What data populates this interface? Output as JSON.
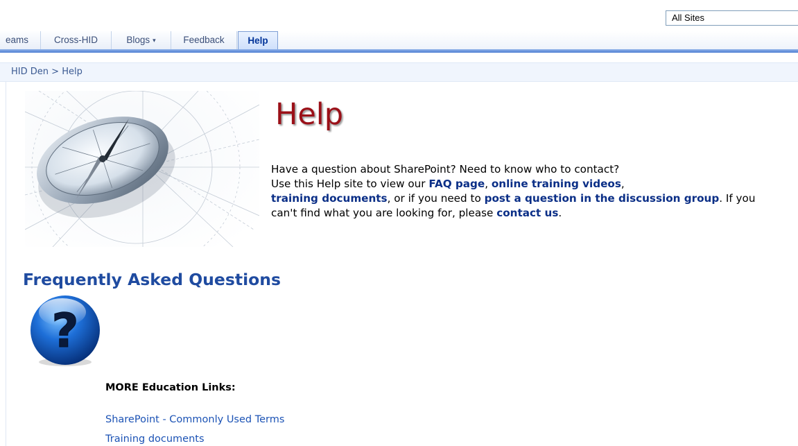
{
  "search": {
    "scope": "All Sites"
  },
  "nav": {
    "tabs": [
      {
        "label": "eams"
      },
      {
        "label": "Cross-HID"
      },
      {
        "label": "Blogs"
      },
      {
        "label": "Feedback"
      },
      {
        "label": "Help"
      }
    ],
    "dropdown_glyph": "▾"
  },
  "breadcrumb": {
    "site": "HID Den",
    "separator": ">",
    "current": "Help"
  },
  "main": {
    "title": "Help",
    "intro": {
      "p1": "Have a question about SharePoint?  Need to know who to contact?",
      "p2": "Use this Help site to view our ",
      "faq_link": "FAQ page",
      "sep1": ", ",
      "videos_link": "online training videos",
      "sep2": ",",
      "docs_link": "training documents",
      "p3": ", or if you need to ",
      "post_link": "post a question in the discussion group",
      "p4": ".  If you can't find what you are looking for, please ",
      "contact_link": "contact us",
      "p5": "."
    },
    "faq_heading": "Frequently Asked Questions",
    "more_heading": "MORE Education Links:",
    "links": [
      {
        "label": "SharePoint - Commonly Used Terms"
      },
      {
        "label": "Training documents"
      }
    ]
  },
  "icons": {
    "hero": "compass-image",
    "faq": "question-mark-icon"
  },
  "colors": {
    "title_red": "#9b1018",
    "link_blue": "#0b2f87",
    "heading_blue": "#1f4ba0",
    "nav_active": "#003399"
  }
}
